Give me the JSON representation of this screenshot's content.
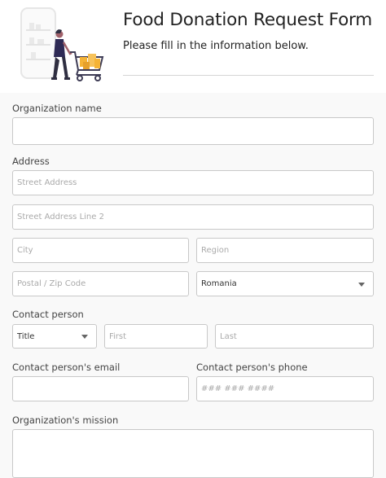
{
  "header": {
    "title": "Food Donation Request Form",
    "subtitle": "Please fill in the information below."
  },
  "form": {
    "org_name_label": "Organization name",
    "org_name_value": "",
    "address_label": "Address",
    "street_placeholder": "Street Address",
    "street2_placeholder": "Street Address Line 2",
    "city_placeholder": "City",
    "region_placeholder": "Region",
    "postal_placeholder": "Postal / Zip Code",
    "country_selected": "Romania",
    "contact_label": "Contact person",
    "title_selected": "Title",
    "first_placeholder": "First",
    "last_placeholder": "Last",
    "email_label": "Contact person's email",
    "phone_label": "Contact person's phone",
    "phone_placeholder": "### ### ####",
    "mission_label": "Organization's mission"
  },
  "illustration": {
    "icon": "shopping-cart-woman-illustration",
    "colors": {
      "figure": "#2e2a55",
      "skin": "#a0616a",
      "cart": "#3f3d56",
      "boxes": "#f5b335",
      "phone": "#f1f1f1"
    }
  }
}
